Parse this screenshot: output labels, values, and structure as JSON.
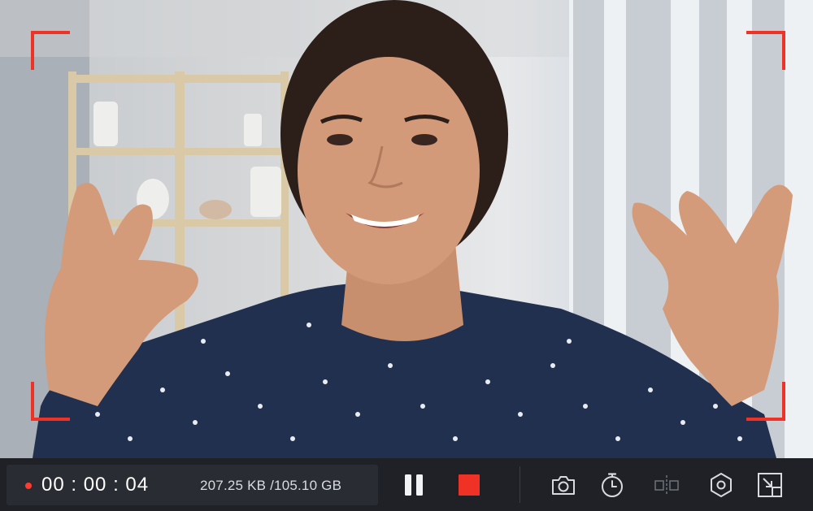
{
  "recording": {
    "timer": "00 : 00 : 04",
    "file_size": "207.25 KB /105.10 GB"
  },
  "colors": {
    "frame_corner": "#f03226",
    "record_dot": "#ff3b30",
    "stop_button": "#f03226",
    "toolbar_bg": "#1f2127",
    "status_panel_bg": "#2a2c33",
    "icon": "#d8dadf",
    "icon_disabled": "#6a6d75"
  },
  "icons": {
    "pause": "pause-icon",
    "stop": "stop-icon",
    "screenshot": "camera-icon",
    "timer": "stopwatch-icon",
    "split": "split-icon",
    "settings": "hexagon-settings-icon",
    "minimize": "shrink-window-icon"
  }
}
